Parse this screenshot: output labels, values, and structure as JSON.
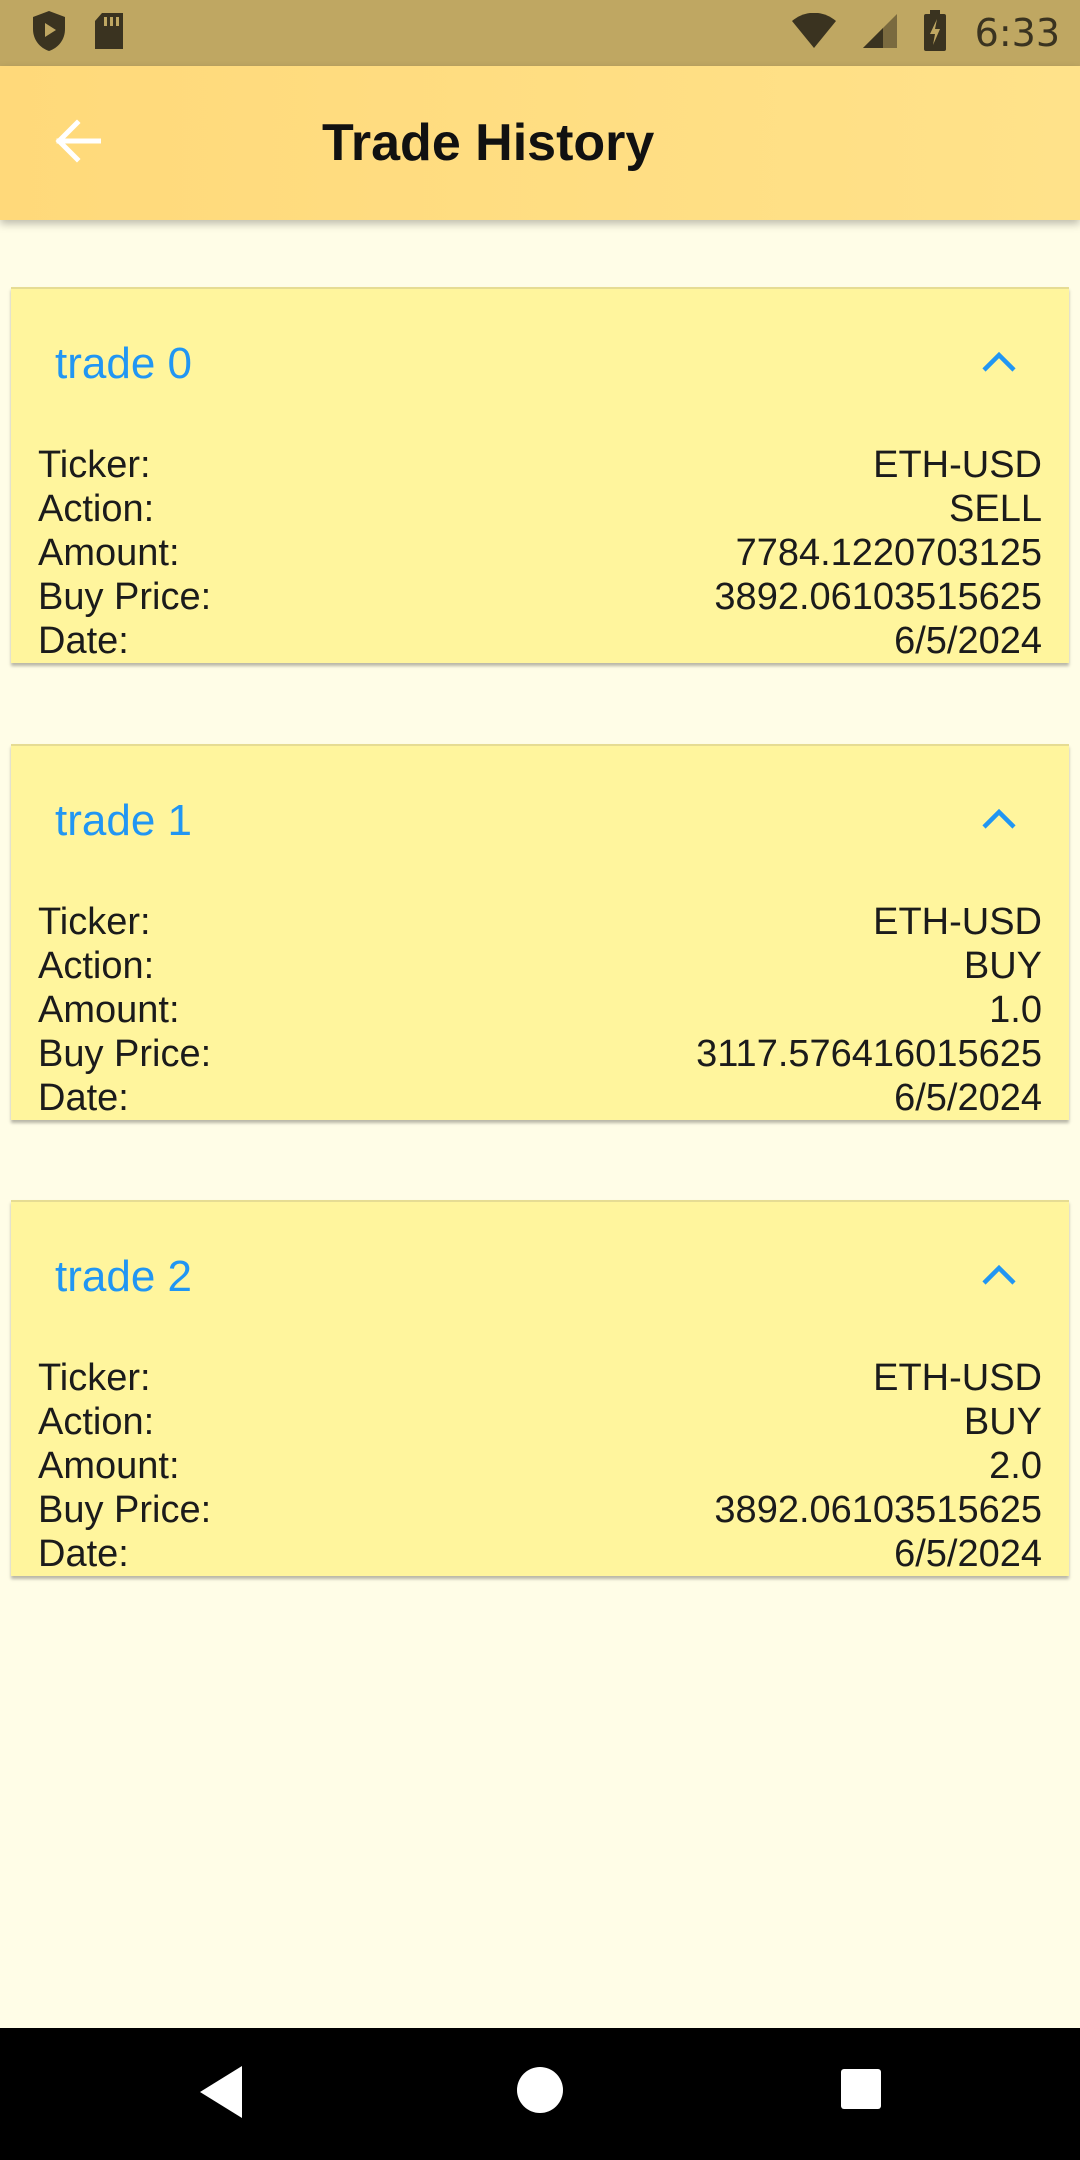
{
  "status_bar": {
    "time": "6:33",
    "icons": [
      "shield-play-icon",
      "sd-card-icon",
      "wifi-icon",
      "cell-signal-icon",
      "battery-icon"
    ]
  },
  "app_bar": {
    "back_icon": "arrow-left-icon",
    "title": "Trade History"
  },
  "colors": {
    "status_bar": "#BFA762",
    "app_bar": "#FFDE82",
    "background": "#FFFDE7",
    "card": "#FFF59D",
    "accent": "#2196F3",
    "nav_bar": "#000000"
  },
  "trades": [
    {
      "title": "trade 0",
      "expanded_icon": "chevron-up-icon",
      "rows": [
        {
          "label": "Ticker:",
          "value": "ETH-USD"
        },
        {
          "label": "Action:",
          "value": "SELL"
        },
        {
          "label": "Amount:",
          "value": "7784.1220703125"
        },
        {
          "label": "Buy Price:",
          "value": "3892.06103515625"
        },
        {
          "label": "Date:",
          "value": "6/5/2024"
        }
      ]
    },
    {
      "title": "trade 1",
      "expanded_icon": "chevron-up-icon",
      "rows": [
        {
          "label": "Ticker:",
          "value": "ETH-USD"
        },
        {
          "label": "Action:",
          "value": "BUY"
        },
        {
          "label": "Amount:",
          "value": "1.0"
        },
        {
          "label": "Buy Price:",
          "value": "3117.576416015625"
        },
        {
          "label": "Date:",
          "value": "6/5/2024"
        }
      ]
    },
    {
      "title": "trade 2",
      "expanded_icon": "chevron-up-icon",
      "rows": [
        {
          "label": "Ticker:",
          "value": "ETH-USD"
        },
        {
          "label": "Action:",
          "value": "BUY"
        },
        {
          "label": "Amount:",
          "value": "2.0"
        },
        {
          "label": "Buy Price:",
          "value": "3892.06103515625"
        },
        {
          "label": "Date:",
          "value": "6/5/2024"
        }
      ]
    }
  ],
  "nav_bar": {
    "buttons": [
      "back-triangle-icon",
      "home-circle-icon",
      "recents-square-icon"
    ]
  }
}
